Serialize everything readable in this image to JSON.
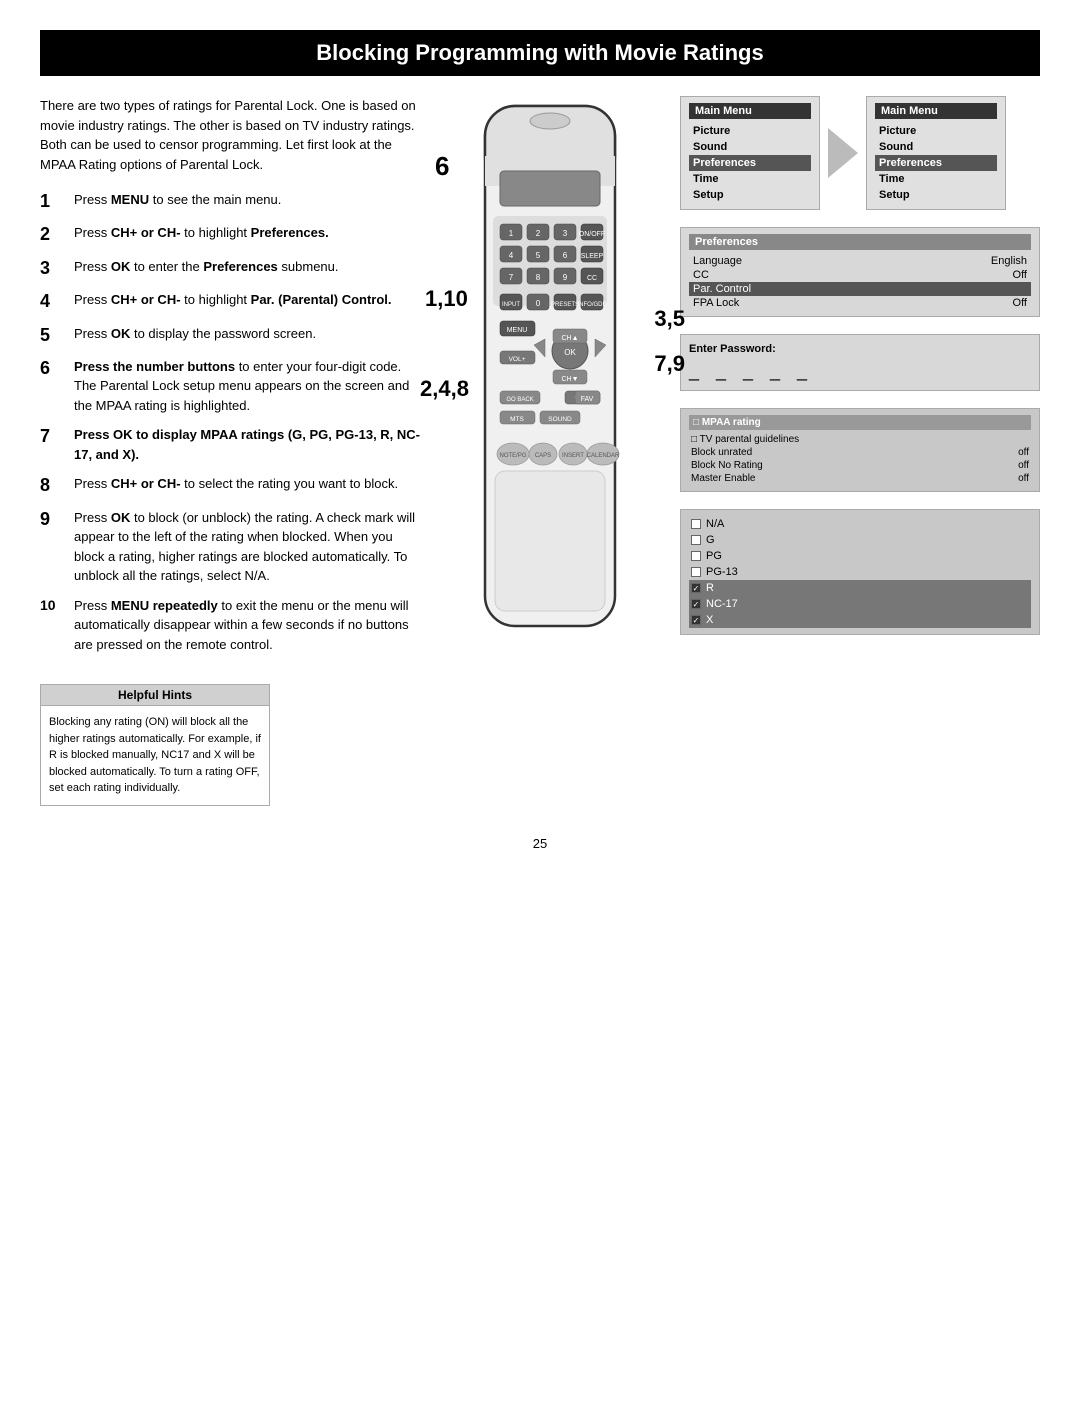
{
  "page": {
    "title": "Blocking Programming with Movie Ratings",
    "number": "25"
  },
  "intro": "There are two types of ratings for Parental Lock. One is based on movie industry ratings. The other is based on TV industry ratings. Both can be used to censor programming. Let first look at the MPAA Rating options of Parental Lock.",
  "steps": [
    {
      "number": "1",
      "text": "Press ",
      "bold": "MENU",
      "rest": " to see the main menu."
    },
    {
      "number": "2",
      "text": "Press ",
      "bold": "CH+ or CH-",
      "rest": " to highlight ",
      "bold2": "Preferences."
    },
    {
      "number": "3",
      "text": "Press ",
      "bold": "OK",
      "rest": " to enter the ",
      "bold2": "Preferences",
      "end": " submenu."
    },
    {
      "number": "4",
      "text": "Press ",
      "bold": "CH+ or CH-",
      "rest": " to highlight ",
      "bold2": "Par. (Parental) Control."
    },
    {
      "number": "5",
      "text": "Press ",
      "bold": "OK",
      "rest": " to display the password screen."
    },
    {
      "number": "6",
      "text": "Press the number buttons",
      "rest": " to enter your four-digit code. The Parental Lock setup menu appears on the screen and the MPAA rating is highlighted."
    },
    {
      "number": "7",
      "text": "Press OK to display MPAA ratings (G, PG, PG-13, R, NC-17, and X)."
    },
    {
      "number": "8",
      "text": "Press ",
      "bold": "CH+ or CH-",
      "rest": " to select the rating you want to block."
    },
    {
      "number": "9",
      "text": "Press ",
      "bold": "OK",
      "rest": " to block (or unblock) the rating. A check mark will appear to the left of the rating when blocked. When you block a rating, higher ratings are blocked automatically. To unblock all the ratings, select N/A."
    },
    {
      "number": "10",
      "text": "Press ",
      "bold": "MENU repeatedly",
      "rest": " to exit the menu or the menu will automatically disappear within a few seconds if no buttons are pressed on the remote control."
    }
  ],
  "step_overlays": {
    "overlay1": "6",
    "overlay2": "1,10",
    "overlay3": "2,4,8",
    "overlay4": "3,5",
    "overlay5": "7,9"
  },
  "main_menu_1": {
    "title": "Main Menu",
    "items": [
      "Picture",
      "Sound",
      "Preferences",
      "Time",
      "Setup"
    ],
    "highlighted": "Preferences"
  },
  "main_menu_2": {
    "title": "Main Menu",
    "items": [
      "Picture",
      "Sound",
      "Preferences",
      "Time",
      "Setup"
    ],
    "highlighted": "Preferences"
  },
  "preferences_screen": {
    "title": "Preferences",
    "rows": [
      {
        "label": "Language",
        "value": "English"
      },
      {
        "label": "CC",
        "value": "Off"
      },
      {
        "label": "Par. Control",
        "value": ""
      },
      {
        "label": "FPA Lock",
        "value": "Off"
      }
    ],
    "highlighted": "Par. Control"
  },
  "password_screen": {
    "label": "Enter Password:",
    "blanks": "_ _ _ _ _"
  },
  "mpaa_screen": {
    "rows": [
      {
        "label": "□ MPAA rating",
        "value": "",
        "highlighted": true
      },
      {
        "label": "□ TV parental guidelines",
        "value": ""
      },
      {
        "label": "Block unrated",
        "value": "off"
      },
      {
        "label": "Block No Rating",
        "value": "off"
      },
      {
        "label": "Master Enable",
        "value": "off"
      }
    ]
  },
  "ratings_screen": {
    "ratings": [
      {
        "label": "N/A",
        "checked": false
      },
      {
        "label": "G",
        "checked": false
      },
      {
        "label": "PG",
        "checked": false
      },
      {
        "label": "PG-13",
        "checked": false
      },
      {
        "label": "R",
        "checked": true
      },
      {
        "label": "NC-17",
        "checked": true
      },
      {
        "label": "X",
        "checked": true
      }
    ]
  },
  "helpful_hints": {
    "title": "Helpful Hints",
    "text": "Blocking any rating (ON) will block all the higher ratings automatically. For example, if R is blocked manually, NC17 and X will be blocked automatically. To turn a rating OFF, set each rating individually."
  }
}
